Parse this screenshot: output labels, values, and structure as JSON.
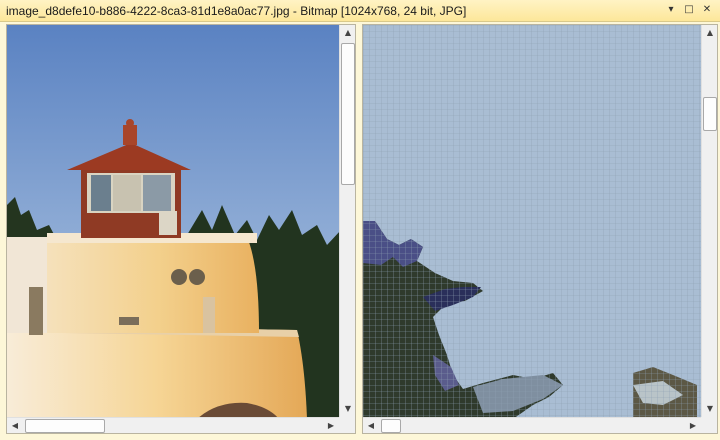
{
  "window": {
    "title": "image_d8defe10-b886-4222-8ca3-81d1e8a0ac77.jpg - Bitmap [1024x768, 24 bit, JPG]"
  },
  "titlebar_buttons": [
    {
      "name": "dropdown-icon",
      "glyph": "▾"
    },
    {
      "name": "maximize-icon",
      "glyph": "□"
    },
    {
      "name": "close-icon",
      "glyph": "✕"
    }
  ],
  "panes": {
    "left": {
      "description": "Normal view: lighthouse at sunset"
    },
    "right": {
      "description": "Zoomed pixel view with pixel grid"
    }
  },
  "scroll_arrows": {
    "up": "▲",
    "down": "▼",
    "left": "◀",
    "right": "▶"
  },
  "colors": {
    "sky_top": "#5b84c4",
    "sky_bottom": "#b9cde4",
    "zoom_sky": "#a7bcd3",
    "title_bg": "#fde79a"
  }
}
